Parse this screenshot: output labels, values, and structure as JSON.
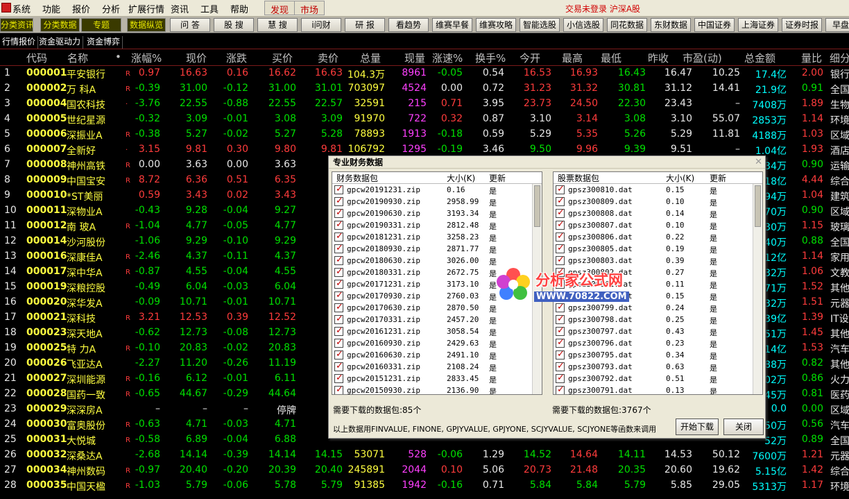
{
  "menu": {
    "items": [
      "系统",
      "功能",
      "报价",
      "分析",
      "扩展行情",
      "资讯",
      "工具",
      "帮助"
    ],
    "buttons": [
      "发现",
      "市场"
    ],
    "status": "交易未登录  沪深A股"
  },
  "toolbar": [
    "分类资讯",
    "分类数据",
    "专题",
    "数据纵览",
    "问 答",
    "股 搜",
    "慧 搜",
    "i问财",
    "研 报",
    "看趋势",
    "维赛早餐",
    "维赛攻略",
    "智能选股",
    "小信选股",
    "同花数据",
    "东财数据",
    "中国证券",
    "上海证券",
    "证券时报",
    "早盘"
  ],
  "subtabs": [
    "行情报价",
    "资金驱动力",
    "资金博弈"
  ],
  "columns": [
    "代码",
    "名称",
    "•",
    "涨幅%",
    "现价",
    "涨跌",
    "买价",
    "卖价",
    "总量",
    "现量",
    "涨速%",
    "换手%",
    "今开",
    "最高",
    "最低",
    "昨收",
    "市盈(动)",
    "总金额",
    "量比",
    "细分"
  ],
  "rows": [
    {
      "n": "1",
      "code": "000001",
      "name": "平安银行",
      "mk": "R",
      "chg": "0.97",
      "price": "16.63",
      "diff": "0.16",
      "buy": "16.62",
      "sell": "16.63",
      "vol": "104.3万",
      "cur": "8961",
      "spd": "-0.05",
      "turn": "0.54",
      "open": "16.53",
      "high": "16.93",
      "low": "16.43",
      "prev": "16.47",
      "pe": "10.25",
      "amt": "17.4亿",
      "ratio": "2.00",
      "sec": "银行"
    },
    {
      "n": "2",
      "code": "000002",
      "name": "万 科A",
      "mk": "R",
      "chg": "-0.39",
      "price": "31.00",
      "diff": "-0.12",
      "buy": "31.00",
      "sell": "31.01",
      "vol": "703097",
      "cur": "4524",
      "spd": "0.00",
      "turn": "0.72",
      "open": "31.23",
      "high": "31.32",
      "low": "30.81",
      "prev": "31.12",
      "pe": "14.41",
      "amt": "21.9亿",
      "ratio": "0.91",
      "sec": "全国"
    },
    {
      "n": "3",
      "code": "000004",
      "name": "国农科技",
      "mk": "·",
      "chg": "-3.76",
      "price": "22.55",
      "diff": "-0.88",
      "buy": "22.55",
      "sell": "22.57",
      "vol": "32591",
      "cur": "215",
      "spd": "0.71",
      "turn": "3.95",
      "open": "23.73",
      "high": "24.50",
      "low": "22.30",
      "prev": "23.43",
      "pe": "–",
      "amt": "7408万",
      "ratio": "1.89",
      "sec": "生物"
    },
    {
      "n": "4",
      "code": "000005",
      "name": "世纪星源",
      "mk": "",
      "chg": "-0.32",
      "price": "3.09",
      "diff": "-0.01",
      "buy": "3.08",
      "sell": "3.09",
      "vol": "91970",
      "cur": "722",
      "spd": "0.32",
      "turn": "0.87",
      "open": "3.10",
      "high": "3.14",
      "low": "3.08",
      "prev": "3.10",
      "pe": "55.07",
      "amt": "2853万",
      "ratio": "1.14",
      "sec": "环境"
    },
    {
      "n": "5",
      "code": "000006",
      "name": "深振业A",
      "mk": "R",
      "chg": "-0.38",
      "price": "5.27",
      "diff": "-0.02",
      "buy": "5.27",
      "sell": "5.28",
      "vol": "78893",
      "cur": "1913",
      "spd": "-0.18",
      "turn": "0.59",
      "open": "5.29",
      "high": "5.35",
      "low": "5.26",
      "prev": "5.29",
      "pe": "11.81",
      "amt": "4188万",
      "ratio": "1.03",
      "sec": "区域"
    },
    {
      "n": "6",
      "code": "000007",
      "name": "全新好",
      "mk": "·",
      "chg": "3.15",
      "price": "9.81",
      "diff": "0.30",
      "buy": "9.80",
      "sell": "9.81",
      "vol": "106792",
      "cur": "1295",
      "spd": "-0.19",
      "turn": "3.46",
      "open": "9.50",
      "high": "9.96",
      "low": "9.39",
      "prev": "9.51",
      "pe": "–",
      "amt": "1.04亿",
      "ratio": "1.93",
      "sec": "酒店"
    },
    {
      "n": "7",
      "code": "000008",
      "name": "神州高铁",
      "mk": "R",
      "chg": "0.00",
      "price": "3.63",
      "diff": "0.00",
      "buy": "3.63",
      "sell": "",
      "vol": "",
      "cur": "",
      "spd": "",
      "turn": "",
      "open": "",
      "high": "",
      "low": "",
      "prev": "",
      "pe": "",
      "amt": "34万",
      "ratio": "0.90",
      "sec": "运输"
    },
    {
      "n": "8",
      "code": "000009",
      "name": "中国宝安",
      "mk": "R",
      "chg": "8.72",
      "price": "6.36",
      "diff": "0.51",
      "buy": "6.35",
      "sell": "",
      "vol": "",
      "cur": "",
      "spd": "",
      "turn": "",
      "open": "",
      "high": "",
      "low": "",
      "prev": "",
      "pe": "",
      "amt": "18亿",
      "ratio": "4.44",
      "sec": "综合"
    },
    {
      "n": "9",
      "code": "000010",
      "name": "*ST美丽",
      "mk": "",
      "chg": "0.59",
      "price": "3.43",
      "diff": "0.02",
      "buy": "3.43",
      "sell": "",
      "vol": "",
      "cur": "",
      "spd": "",
      "turn": "",
      "open": "",
      "high": "",
      "low": "",
      "prev": "",
      "pe": "",
      "amt": "94万",
      "ratio": "1.04",
      "sec": "建筑"
    },
    {
      "n": "10",
      "code": "000011",
      "name": "深物业A",
      "mk": "",
      "chg": "-0.43",
      "price": "9.28",
      "diff": "-0.04",
      "buy": "9.27",
      "sell": "",
      "vol": "",
      "cur": "",
      "spd": "",
      "turn": "",
      "open": "",
      "high": "",
      "low": "",
      "prev": "",
      "pe": "",
      "amt": "70万",
      "ratio": "0.90",
      "sec": "区域"
    },
    {
      "n": "11",
      "code": "000012",
      "name": "南 玻A",
      "mk": "R",
      "chg": "-1.04",
      "price": "4.77",
      "diff": "-0.05",
      "buy": "4.77",
      "sell": "",
      "vol": "",
      "cur": "",
      "spd": "",
      "turn": "",
      "open": "",
      "high": "",
      "low": "",
      "prev": "",
      "pe": "",
      "amt": "30万",
      "ratio": "1.15",
      "sec": "玻璃"
    },
    {
      "n": "12",
      "code": "000014",
      "name": "沙河股份",
      "mk": "",
      "chg": "-1.06",
      "price": "9.29",
      "diff": "-0.10",
      "buy": "9.29",
      "sell": "",
      "vol": "",
      "cur": "",
      "spd": "",
      "turn": "",
      "open": "",
      "high": "",
      "low": "",
      "prev": "",
      "pe": "",
      "amt": "40万",
      "ratio": "0.88",
      "sec": "全国"
    },
    {
      "n": "13",
      "code": "000016",
      "name": "深康佳A",
      "mk": "R",
      "chg": "-2.46",
      "price": "4.37",
      "diff": "-0.11",
      "buy": "4.37",
      "sell": "",
      "vol": "",
      "cur": "",
      "spd": "",
      "turn": "",
      "open": "",
      "high": "",
      "low": "",
      "prev": "",
      "pe": "",
      "amt": "12亿",
      "ratio": "1.14",
      "sec": "家用"
    },
    {
      "n": "14",
      "code": "000017",
      "name": "深中华A",
      "mk": "R",
      "chg": "-0.87",
      "price": "4.55",
      "diff": "-0.04",
      "buy": "4.55",
      "sell": "",
      "vol": "",
      "cur": "",
      "spd": "",
      "turn": "",
      "open": "",
      "high": "",
      "low": "",
      "prev": "",
      "pe": "",
      "amt": "32万",
      "ratio": "1.06",
      "sec": "文教"
    },
    {
      "n": "15",
      "code": "000019",
      "name": "深粮控股",
      "mk": "",
      "chg": "-0.49",
      "price": "6.04",
      "diff": "-0.03",
      "buy": "6.04",
      "sell": "",
      "vol": "",
      "cur": "",
      "spd": "",
      "turn": "",
      "open": "",
      "high": "",
      "low": "",
      "prev": "",
      "pe": "",
      "amt": "71万",
      "ratio": "1.52",
      "sec": "其他"
    },
    {
      "n": "16",
      "code": "000020",
      "name": "深华发A",
      "mk": "",
      "chg": "-0.09",
      "price": "10.71",
      "diff": "-0.01",
      "buy": "10.71",
      "sell": "10",
      "vol": "",
      "cur": "",
      "spd": "",
      "turn": "",
      "open": "",
      "high": "",
      "low": "",
      "prev": "",
      "pe": "",
      "amt": "32万",
      "ratio": "1.51",
      "sec": "元器"
    },
    {
      "n": "17",
      "code": "000021",
      "name": "深科技",
      "mk": "R",
      "chg": "3.21",
      "price": "12.53",
      "diff": "0.39",
      "buy": "12.52",
      "sell": "12",
      "vol": "",
      "cur": "",
      "spd": "",
      "turn": "",
      "open": "",
      "high": "",
      "low": "",
      "prev": "",
      "pe": "",
      "amt": "39亿",
      "ratio": "1.39",
      "sec": "IT设"
    },
    {
      "n": "18",
      "code": "000023",
      "name": "深天地A",
      "mk": "",
      "chg": "-0.62",
      "price": "12.73",
      "diff": "-0.08",
      "buy": "12.73",
      "sell": "12",
      "vol": "",
      "cur": "",
      "spd": "",
      "turn": "",
      "open": "",
      "high": "",
      "low": "",
      "prev": "",
      "pe": "",
      "amt": "51万",
      "ratio": "1.45",
      "sec": "其他"
    },
    {
      "n": "19",
      "code": "000025",
      "name": "特 力A",
      "mk": "R",
      "chg": "-0.10",
      "price": "20.83",
      "diff": "-0.02",
      "buy": "20.83",
      "sell": "20",
      "vol": "",
      "cur": "",
      "spd": "",
      "turn": "",
      "open": "",
      "high": "",
      "low": "",
      "prev": "",
      "pe": "",
      "amt": "14亿",
      "ratio": "1.53",
      "sec": "汽车"
    },
    {
      "n": "20",
      "code": "000026",
      "name": "飞亚达A",
      "mk": "",
      "chg": "-2.27",
      "price": "11.20",
      "diff": "-0.26",
      "buy": "11.19",
      "sell": "11",
      "vol": "",
      "cur": "",
      "spd": "",
      "turn": "",
      "open": "",
      "high": "",
      "low": "",
      "prev": "",
      "pe": "",
      "amt": "88万",
      "ratio": "0.82",
      "sec": "其他"
    },
    {
      "n": "21",
      "code": "000027",
      "name": "深圳能源",
      "mk": "R",
      "chg": "-0.16",
      "price": "6.12",
      "diff": "-0.01",
      "buy": "6.11",
      "sell": "6",
      "vol": "",
      "cur": "",
      "spd": "",
      "turn": "",
      "open": "",
      "high": "",
      "low": "",
      "prev": "",
      "pe": "",
      "amt": "02万",
      "ratio": "0.86",
      "sec": "火力"
    },
    {
      "n": "22",
      "code": "000028",
      "name": "国药一致",
      "mk": "R",
      "chg": "-0.65",
      "price": "44.67",
      "diff": "-0.29",
      "buy": "44.64",
      "sell": "44",
      "vol": "",
      "cur": "",
      "spd": "",
      "turn": "",
      "open": "",
      "high": "",
      "low": "",
      "prev": "",
      "pe": "",
      "amt": "45万",
      "ratio": "0.81",
      "sec": "医药"
    },
    {
      "n": "23",
      "code": "000029",
      "name": "深深房A",
      "mk": "",
      "chg": "–",
      "price": "–",
      "diff": "–",
      "buy": "停牌",
      "sell": "",
      "vol": "",
      "cur": "",
      "spd": "",
      "turn": "",
      "open": "",
      "high": "",
      "low": "",
      "prev": "",
      "pe": "",
      "amt": "0.0",
      "ratio": "0.00",
      "sec": "区域"
    },
    {
      "n": "24",
      "code": "000030",
      "name": "富奥股份",
      "mk": "R",
      "chg": "-0.63",
      "price": "4.71",
      "diff": "-0.03",
      "buy": "4.71",
      "sell": "",
      "vol": "",
      "cur": "",
      "spd": "",
      "turn": "",
      "open": "",
      "high": "",
      "low": "",
      "prev": "",
      "pe": "",
      "amt": "50万",
      "ratio": "0.56",
      "sec": "汽车"
    },
    {
      "n": "25",
      "code": "000031",
      "name": "大悦城",
      "mk": "R",
      "chg": "-0.58",
      "price": "6.89",
      "diff": "-0.04",
      "buy": "6.88",
      "sell": "",
      "vol": "",
      "cur": "",
      "spd": "",
      "turn": "",
      "open": "",
      "high": "",
      "low": "",
      "prev": "",
      "pe": "",
      "amt": "52万",
      "ratio": "0.89",
      "sec": "全国"
    },
    {
      "n": "26",
      "code": "000032",
      "name": "深桑达A",
      "mk": "",
      "chg": "-2.68",
      "price": "14.14",
      "diff": "-0.39",
      "buy": "14.14",
      "sell": "14.15",
      "vol": "53071",
      "cur": "528",
      "spd": "-0.06",
      "turn": "1.29",
      "open": "14.52",
      "high": "14.64",
      "low": "14.11",
      "prev": "14.53",
      "pe": "50.12",
      "amt": "7600万",
      "ratio": "1.21",
      "sec": "元器"
    },
    {
      "n": "27",
      "code": "000034",
      "name": "神州数码",
      "mk": "R",
      "chg": "-0.97",
      "price": "20.40",
      "diff": "-0.20",
      "buy": "20.39",
      "sell": "20.40",
      "vol": "245891",
      "cur": "2044",
      "spd": "0.10",
      "turn": "5.06",
      "open": "20.73",
      "high": "21.48",
      "low": "20.35",
      "prev": "20.60",
      "pe": "19.62",
      "amt": "5.15亿",
      "ratio": "1.42",
      "sec": "综合"
    },
    {
      "n": "28",
      "code": "000035",
      "name": "中国天楹",
      "mk": "R",
      "chg": "-1.03",
      "price": "5.79",
      "diff": "-0.06",
      "buy": "5.78",
      "sell": "5.79",
      "vol": "91385",
      "cur": "1942",
      "spd": "-0.16",
      "turn": "0.71",
      "open": "5.84",
      "high": "5.84",
      "low": "5.79",
      "prev": "5.85",
      "pe": "29.05",
      "amt": "5313万",
      "ratio": "1.17",
      "sec": "环境"
    }
  ],
  "dialog": {
    "title": "专业财务数据",
    "left_headers": [
      "财务数据包",
      "大小(K)",
      "更新"
    ],
    "right_headers": [
      "股票数据包",
      "大小(K)",
      "更新"
    ],
    "left_rows": [
      [
        "gpcw20191231.zip",
        "0.16",
        "是"
      ],
      [
        "gpcw20190930.zip",
        "2958.99",
        "是"
      ],
      [
        "gpcw20190630.zip",
        "3193.34",
        "是"
      ],
      [
        "gpcw20190331.zip",
        "2812.48",
        "是"
      ],
      [
        "gpcw20181231.zip",
        "3258.23",
        "是"
      ],
      [
        "gpcw20180930.zip",
        "2871.77",
        "是"
      ],
      [
        "gpcw20180630.zip",
        "3026.00",
        "是"
      ],
      [
        "gpcw20180331.zip",
        "2672.75",
        "是"
      ],
      [
        "gpcw20171231.zip",
        "3173.10",
        "是"
      ],
      [
        "gpcw20170930.zip",
        "2760.03",
        "是"
      ],
      [
        "gpcw20170630.zip",
        "2870.50",
        "是"
      ],
      [
        "gpcw20170331.zip",
        "2457.20",
        "是"
      ],
      [
        "gpcw20161231.zip",
        "3058.54",
        "是"
      ],
      [
        "gpcw20160930.zip",
        "2429.63",
        "是"
      ],
      [
        "gpcw20160630.zip",
        "2491.10",
        "是"
      ],
      [
        "gpcw20160331.zip",
        "2108.24",
        "是"
      ],
      [
        "gpcw20151231.zip",
        "2833.45",
        "是"
      ],
      [
        "gpcw20150930.zip",
        "2136.90",
        "是"
      ]
    ],
    "right_rows": [
      [
        "gpsz300810.dat",
        "0.15",
        "是"
      ],
      [
        "gpsz300809.dat",
        "0.10",
        "是"
      ],
      [
        "gpsz300808.dat",
        "0.14",
        "是"
      ],
      [
        "gpsz300807.dat",
        "0.10",
        "是"
      ],
      [
        "gpsz300806.dat",
        "0.22",
        "是"
      ],
      [
        "gpsz300805.dat",
        "0.19",
        "是"
      ],
      [
        "gpsz300803.dat",
        "0.39",
        "是"
      ],
      [
        "gpsz300802.dat",
        "0.27",
        "是"
      ],
      [
        "gpsz300801.dat",
        "0.11",
        "是"
      ],
      [
        "gpsz300800.dat",
        "0.15",
        "是"
      ],
      [
        "gpsz300799.dat",
        "0.24",
        "是"
      ],
      [
        "gpsz300798.dat",
        "0.25",
        "是"
      ],
      [
        "gpsz300797.dat",
        "0.43",
        "是"
      ],
      [
        "gpsz300796.dat",
        "0.23",
        "是"
      ],
      [
        "gpsz300795.dat",
        "0.34",
        "是"
      ],
      [
        "gpsz300793.dat",
        "0.63",
        "是"
      ],
      [
        "gpsz300792.dat",
        "0.51",
        "是"
      ],
      [
        "gpsz300791.dat",
        "0.13",
        "是"
      ]
    ],
    "left_count": "需要下载的数据包:85个",
    "right_count": "需要下载的数据包:3767个",
    "note": "以上数据用FINVALUE, FINONE, GPJYVALUE, GPJYONE, SCJYVALUE, SCJYONE等函数来调用",
    "start_button": "开始下载",
    "close_button": "关闭"
  },
  "watermark": {
    "title": "分析家公式网",
    "url": "WWW.70822.COM"
  }
}
